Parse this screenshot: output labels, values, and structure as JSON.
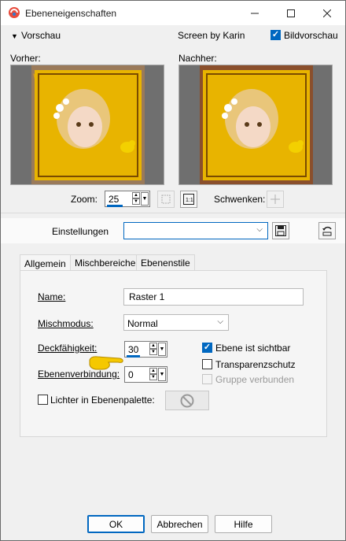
{
  "window": {
    "title": "Ebeneneigenschaften"
  },
  "preview": {
    "toggle_label": "Vorschau",
    "credit": "Screen by Karin",
    "preview_checkbox_label": "Bildvorschau",
    "before_label": "Vorher:",
    "after_label": "Nachher:",
    "zoom_label": "Zoom:",
    "zoom_value": "25",
    "pan_label": "Schwenken:"
  },
  "settings": {
    "label": "Einstellungen",
    "value": ""
  },
  "tabs": [
    {
      "label": "Allgemein"
    },
    {
      "label": "Mischbereiche"
    },
    {
      "label": "Ebenenstile"
    }
  ],
  "general": {
    "name_label": "Name:",
    "name_value": "Raster 1",
    "blend_label": "Mischmodus:",
    "blend_value": "Normal",
    "opacity_label": "Deckfähigkeit:",
    "opacity_value": "30",
    "link_label": "Ebenenverbindung:",
    "link_value": "0",
    "visible_label": "Ebene ist sichtbar",
    "transparency_label": "Transparenzschutz",
    "group_label": "Gruppe verbunden",
    "highlight_label": "Lichter in Ebenenpalette:"
  },
  "buttons": {
    "ok": "OK",
    "cancel": "Abbrechen",
    "help": "Hilfe"
  },
  "colors": {
    "accent": "#0067c0",
    "frame_gold": "#e8b400",
    "after_bg": "#8a4f2c"
  }
}
